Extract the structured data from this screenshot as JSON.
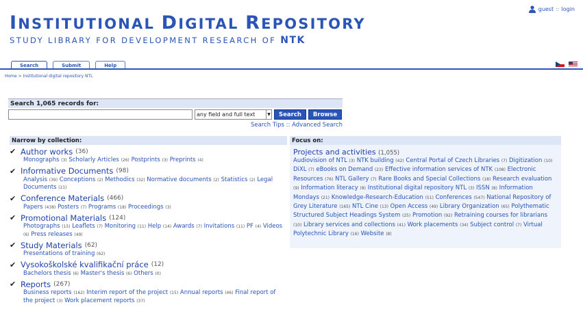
{
  "header": {
    "title_pre": "I",
    "title_mid1": "NSTITUTIONAL ",
    "title_d": "D",
    "title_mid2": "IGITAL ",
    "title_r": "R",
    "title_mid3": "EPOSITORY",
    "subtitle": "STUDY LIBRARY FOR DEVELOPMENT RESEARCH OF",
    "subtitle_org": "NTK"
  },
  "user": {
    "name": "guest",
    "sep": "::",
    "login": "login"
  },
  "tabs": [
    {
      "label": "Search",
      "active": true
    },
    {
      "label": "Submit",
      "active": false
    },
    {
      "label": "Help",
      "active": false
    }
  ],
  "breadcrumb": "Home > Institutional digital repository NTL",
  "search": {
    "label": "Search 1,065 records for:",
    "input_value": "",
    "field_select": "any field and full text",
    "search_button": "Search",
    "browse_button": "Browse",
    "tips_link": "Search Tips",
    "links_sep": "::",
    "advanced_link": "Advanced Search"
  },
  "narrow": {
    "heading": "Narrow by collection:",
    "collections": [
      {
        "name": "Author works",
        "count": "(36)",
        "subs": [
          [
            "Monographs",
            "(3)"
          ],
          [
            "Scholarly Articles",
            "(26)"
          ],
          [
            "Postprints",
            "(3)"
          ],
          [
            "Preprints",
            "(4)"
          ]
        ]
      },
      {
        "name": "Informative Documents",
        "count": "(98)",
        "subs": [
          [
            "Analysis",
            "(39)"
          ],
          [
            "Conceptions",
            "(2)"
          ],
          [
            "Methodics",
            "(32)"
          ],
          [
            "Normative documents",
            "(2)"
          ],
          [
            "Statistics",
            "(2)"
          ],
          [
            "Legal Documents",
            "(21)"
          ]
        ]
      },
      {
        "name": "Conference Materials",
        "count": "(466)",
        "subs": [
          [
            "Papers",
            "(438)"
          ],
          [
            "Posters",
            "(7)"
          ],
          [
            "Programs",
            "(18)"
          ],
          [
            "Proceedings",
            "(3)"
          ]
        ]
      },
      {
        "name": "Promotional Materials",
        "count": "(124)",
        "subs": [
          [
            "Photographs",
            "(15)"
          ],
          [
            "Leaflets",
            "(7)"
          ],
          [
            "Monitoring",
            "(11)"
          ],
          [
            "Help",
            "(14)"
          ],
          [
            "Awards",
            "(7)"
          ],
          [
            "Invitations",
            "(11)"
          ],
          [
            "PF",
            "(4)"
          ],
          [
            "Videos",
            "(6)"
          ],
          [
            "Press releases",
            "(49)"
          ]
        ]
      },
      {
        "name": "Study Materials",
        "count": "(62)",
        "subs": [
          [
            "Presentations of training",
            "(62)"
          ]
        ]
      },
      {
        "name": "Vysokoškolské kvalifikační práce",
        "count": "(12)",
        "subs": [
          [
            "Bachelors thesis",
            "(6)"
          ],
          [
            "Master's thesis",
            "(6)"
          ],
          [
            "Others",
            "(0)"
          ]
        ]
      },
      {
        "name": "Reports",
        "count": "(267)",
        "subs": [
          [
            "Business reports",
            "(162)"
          ],
          [
            "Interim report of the project",
            "(15)"
          ],
          [
            "Annual reports",
            "(46)"
          ],
          [
            "Final report of the project",
            "(3)"
          ],
          [
            "Work placement reports",
            "(37)"
          ]
        ]
      }
    ]
  },
  "focus": {
    "heading": "Focus on:",
    "title": "Projects and activities",
    "count": "(1,055)",
    "subs": [
      [
        "Audiovision of NTL",
        "(3)"
      ],
      [
        "NTK building",
        "(42)"
      ],
      [
        "Central Portal of Czech Libraries",
        "(7)"
      ],
      [
        "Digitization",
        "(10)"
      ],
      [
        "DiXL",
        "(7)"
      ],
      [
        "eBooks on Demand",
        "(23)"
      ],
      [
        "Effective information services of NTK",
        "(108)"
      ],
      [
        "Electronic Resources",
        "(76)"
      ],
      [
        "NTL Gallery",
        "(7)"
      ],
      [
        "Rare Books and Special Collections",
        "(18)"
      ],
      [
        "Research evaluation",
        "(9)"
      ],
      [
        "Information literacy",
        "(8)"
      ],
      [
        "Institutional digital repository NTL",
        "(3)"
      ],
      [
        "ISSN",
        "(8)"
      ],
      [
        "Information Mondays",
        "(21)"
      ],
      [
        "Knowledge-Research-Education",
        "(51)"
      ],
      [
        "Conferences",
        "(547)"
      ],
      [
        "National Repository of Grey Literature",
        "(165)"
      ],
      [
        "NTL Cine",
        "(13)"
      ],
      [
        "Open Access",
        "(49)"
      ],
      [
        "Library Organization",
        "(65)"
      ],
      [
        "Polythematic Structured Subject Headings System",
        "(25)"
      ],
      [
        "Promotion",
        "(92)"
      ],
      [
        "Retraining courses for librarians",
        "(10)"
      ],
      [
        "Library services and collections",
        "(41)"
      ],
      [
        "Work placements",
        "(34)"
      ],
      [
        "Subject control",
        "(7)"
      ],
      [
        "Virtual Polytechnic Library",
        "(16)"
      ],
      [
        "Website",
        "(8)"
      ]
    ]
  },
  "colors": {
    "brand": "#2a54b5",
    "panel": "#dde6f7",
    "focus_bg": "#eef3fc"
  }
}
